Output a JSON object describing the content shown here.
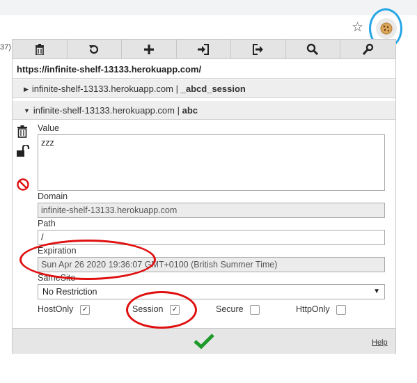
{
  "browser": {
    "url_fragment": "37)",
    "extension_icon": "cookie-icon"
  },
  "toolbar": {
    "buttons": [
      {
        "name": "delete-all-icon"
      },
      {
        "name": "refresh-icon"
      },
      {
        "name": "add-icon"
      },
      {
        "name": "import-icon"
      },
      {
        "name": "export-icon"
      },
      {
        "name": "search-icon"
      },
      {
        "name": "options-icon"
      }
    ]
  },
  "page_url": "https://infinite-shelf-13133.herokuapp.com/",
  "cookies": [
    {
      "domain": "infinite-shelf-13133.herokuapp.com",
      "separator": "|",
      "name": "_abcd_session",
      "expanded": false
    },
    {
      "domain": "infinite-shelf-13133.herokuapp.com",
      "separator": "|",
      "name": "abc",
      "expanded": true
    }
  ],
  "detail": {
    "value_label": "Value",
    "value": "zzz",
    "domain_label": "Domain",
    "domain": "infinite-shelf-13133.herokuapp.com",
    "path_label": "Path",
    "path": "/",
    "expiration_label": "Expiration",
    "expiration": "Sun Apr 26 2020 19:36:07 GMT+0100 (British Summer Time)",
    "samesite_label": "SameSite",
    "samesite": "No Restriction",
    "hostonly_label": "HostOnly",
    "hostonly_checked": true,
    "session_label": "Session",
    "session_checked": true,
    "secure_label": "Secure",
    "secure_checked": false,
    "httponly_label": "HttpOnly",
    "httponly_checked": false
  },
  "footer": {
    "help_label": "Help"
  },
  "colors": {
    "annotation_red": "#e01010",
    "annotation_blue": "#27a6e6",
    "confirm_green": "#1e9a2a"
  }
}
